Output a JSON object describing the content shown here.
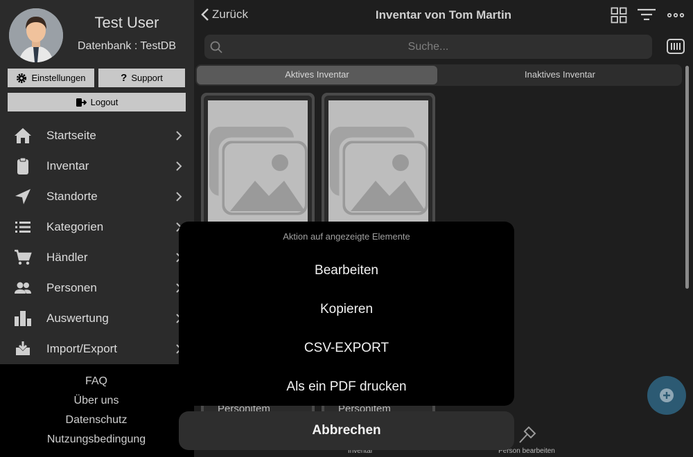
{
  "user": {
    "name": "Test User",
    "database": "Datenbank : TestDB"
  },
  "sidebar": {
    "buttons": {
      "settings": "Einstellungen",
      "support": "Support",
      "logout": "Logout"
    },
    "items": [
      {
        "label": "Startseite",
        "icon": "home-icon"
      },
      {
        "label": "Inventar",
        "icon": "clipboard-icon"
      },
      {
        "label": "Standorte",
        "icon": "location-arrow-icon"
      },
      {
        "label": "Kategorien",
        "icon": "list-icon"
      },
      {
        "label": "Händler",
        "icon": "cart-icon"
      },
      {
        "label": "Personen",
        "icon": "people-icon"
      },
      {
        "label": "Auswertung",
        "icon": "bar-chart-icon"
      },
      {
        "label": "Import/Export",
        "icon": "download-icon"
      }
    ],
    "footer": [
      "FAQ",
      "Über uns",
      "Datenschutz",
      "Nutzungsbedingung"
    ]
  },
  "header": {
    "back": "Zurück",
    "title": "Inventar von Tom Martin"
  },
  "search": {
    "placeholder": "Suche..."
  },
  "segments": {
    "active": "Aktives Inventar",
    "inactive": "Inaktives Inventar"
  },
  "cards": [
    {
      "label": "Personitem"
    },
    {
      "label": "Personitem"
    }
  ],
  "tabbar": {
    "inventory": "Inventar",
    "edit_person": "Person bearbeiten"
  },
  "action_sheet": {
    "title": "Aktion auf angezeigte Elemente",
    "actions": [
      "Bearbeiten",
      "Kopieren",
      "CSV-EXPORT",
      "Als ein PDF drucken"
    ],
    "cancel": "Abbrechen"
  },
  "colors": {
    "accent": "#2c5a73",
    "sidebar": "#2b2b2b",
    "sheet": "#000000"
  }
}
